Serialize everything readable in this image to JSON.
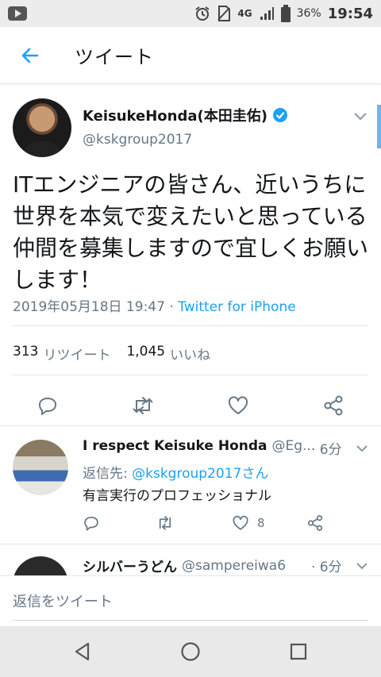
{
  "status_bar": {
    "network": "4G",
    "battery_percent": "36%",
    "time": "19:54"
  },
  "app_bar": {
    "title": "ツイート"
  },
  "tweet": {
    "author_name": "KeisukeHonda(本田圭佑)",
    "handle": "@kskgroup2017",
    "text": "ITエンジニアの皆さん、近いうちに世界を本気で変えたいと思っている仲間を募集しますので宜しくお願いします！",
    "timestamp": "2019年05月18日 19:47 · ",
    "source": "Twitter for iPhone",
    "retweet_count": "313",
    "retweet_label": "リツイート",
    "like_count": "1,045",
    "like_label": "いいね"
  },
  "replies": [
    {
      "name": "I respect Keisuke Honda",
      "handle": "@Eg...",
      "time": "· 6分",
      "reply_prefix": "返信先: ",
      "reply_to": "@kskgroup2017さん",
      "text": "有言実行のプロフェッショナル",
      "like_count": "8"
    },
    {
      "name": "シルバーうどん",
      "handle": "@sampereiwa6",
      "time": "· 6分"
    }
  ],
  "compose": {
    "placeholder": "返信をツイート"
  },
  "colors": {
    "accent": "#1da1f2",
    "secondary_text": "#657786",
    "divider": "#e1e8ed"
  }
}
